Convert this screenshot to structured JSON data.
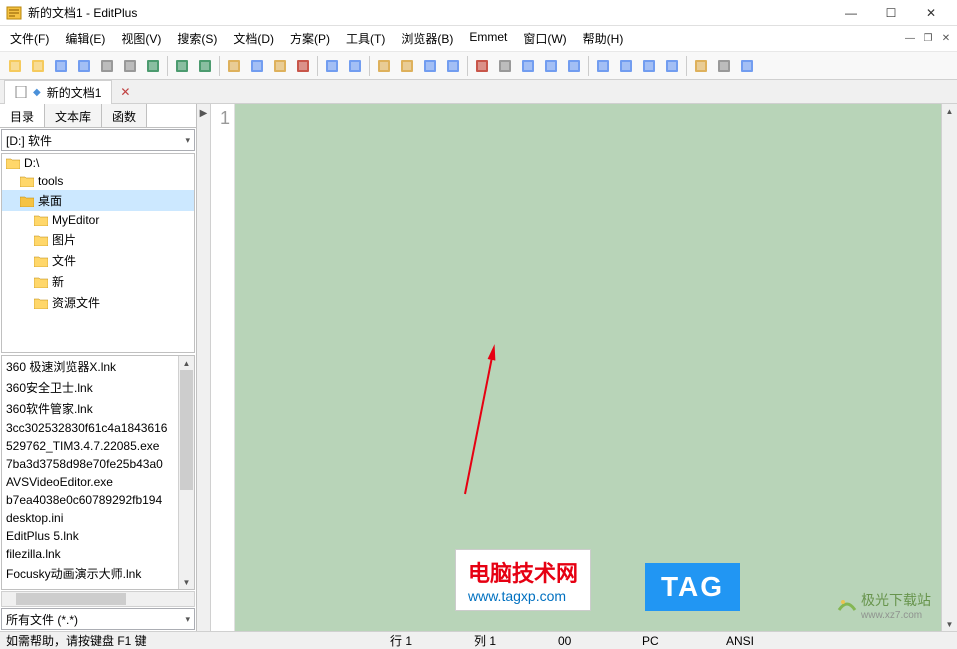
{
  "title": "新的文档1 - EditPlus",
  "menus": [
    "文件(F)",
    "编辑(E)",
    "视图(V)",
    "搜索(S)",
    "文档(D)",
    "方案(P)",
    "工具(T)",
    "浏览器(B)",
    "Emmet",
    "窗口(W)",
    "帮助(H)"
  ],
  "toolbar_icons": [
    "new-file",
    "open-file",
    "save-file",
    "save-all",
    "print",
    "print-preview",
    "spell-check",
    "sep",
    "undo",
    "redo",
    "sep",
    "cut",
    "copy",
    "paste",
    "delete",
    "sep",
    "back",
    "forward",
    "sep",
    "find",
    "find-replace",
    "bookmark",
    "word-wrap",
    "sep",
    "font-size",
    "hex",
    "word",
    "line-numbers",
    "char-map",
    "sep",
    "browser-ie",
    "browser-edge",
    "browser",
    "tile-h",
    "sep",
    "macro",
    "settings",
    "help"
  ],
  "toolbar_colors": {
    "new-file": "#f5c242",
    "open-file": "#f5c242",
    "save-file": "#5b8def",
    "save-all": "#5b8def",
    "print": "#888",
    "print-preview": "#888",
    "spell-check": "#2e8b57",
    "undo": "#2e8b57",
    "redo": "#2e8b57",
    "cut": "#d9a441",
    "copy": "#5b8def",
    "paste": "#d9a441",
    "delete": "#c0392b",
    "back": "#5b8def",
    "forward": "#5b8def",
    "find": "#d9a441",
    "find-replace": "#d9a441",
    "bookmark": "#5b8def",
    "word-wrap": "#5b8def",
    "font-size": "#c0392b",
    "hex": "#888",
    "word": "#5b8def",
    "line-numbers": "#5b8def",
    "char-map": "#5b8def",
    "browser-ie": "#5b8def",
    "browser-edge": "#5b8def",
    "browser": "#5b8def",
    "tile-h": "#5b8def",
    "macro": "#d9a441",
    "settings": "#888",
    "help": "#5b8def"
  },
  "doc_tab": {
    "name": "新的文档1"
  },
  "sidebar": {
    "tabs": [
      "目录",
      "文本库",
      "函数"
    ],
    "drive": "[D:] 软件",
    "tree": [
      {
        "label": "D:\\",
        "level": 0
      },
      {
        "label": "tools",
        "level": 1
      },
      {
        "label": "桌面",
        "level": 1,
        "selected": true
      },
      {
        "label": "MyEditor",
        "level": 2
      },
      {
        "label": "图片",
        "level": 2
      },
      {
        "label": "文件",
        "level": 2
      },
      {
        "label": "新",
        "level": 2
      },
      {
        "label": "资源文件",
        "level": 2
      }
    ],
    "files": [
      "360 极速浏览器X.lnk",
      "360安全卫士.lnk",
      "360软件管家.lnk",
      "3cc302532830f61c4a1843616",
      "529762_TIM3.4.7.22085.exe",
      "7ba3d3758d98e70fe25b43a0",
      "AVSVideoEditor.exe",
      "b7ea4038e0c60789292fb194",
      "desktop.ini",
      "EditPlus 5.lnk",
      "filezilla.lnk",
      "Focusky动画演示大师.lnk"
    ],
    "filter": "所有文件 (*.*)"
  },
  "editor": {
    "line_number": "1"
  },
  "watermarks": {
    "w1_line1": "电脑技术网",
    "w1_line2": "www.tagxp.com",
    "w2": "TAG",
    "w3": "极光下载站",
    "w3_url": "www.xz7.com"
  },
  "status": {
    "hint": "如需帮助，请按键盘 F1 键",
    "row_label": "行",
    "row": "1",
    "col_label": "列",
    "col": "1",
    "total": "00",
    "mode": "PC",
    "encoding": "ANSI"
  }
}
